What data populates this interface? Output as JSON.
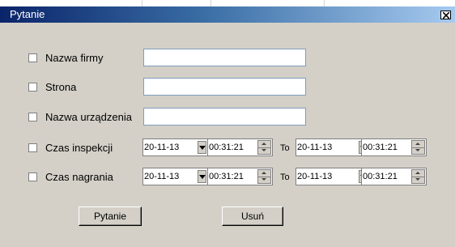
{
  "window": {
    "title": "Pytanie",
    "close_icon": "close-icon"
  },
  "fields": {
    "company_name": {
      "label": "Nazwa firmy",
      "value": "",
      "checked": false
    },
    "site": {
      "label": "Strona",
      "value": "",
      "checked": false
    },
    "device_name": {
      "label": "Nazwa urządzenia",
      "value": "",
      "checked": false
    }
  },
  "inspection_time": {
    "label": "Czas inspekcji",
    "checked": false,
    "from_date": "20-11-13",
    "from_time": "00:31:21",
    "to_label": "To",
    "to_date": "20-11-13",
    "to_time": "00:31:21"
  },
  "recording_time": {
    "label": "Czas nagrania",
    "checked": false,
    "from_date": "20-11-13",
    "from_time": "00:31:21",
    "to_label": "To",
    "to_date": "20-11-13",
    "to_time": "00:31:21"
  },
  "buttons": {
    "query_label": "Pytanie",
    "delete_label": "Usuń"
  },
  "colors": {
    "titlebar_start": "#0a246a",
    "titlebar_end": "#a6caf0",
    "dialog_background": "#d4d0c8"
  }
}
